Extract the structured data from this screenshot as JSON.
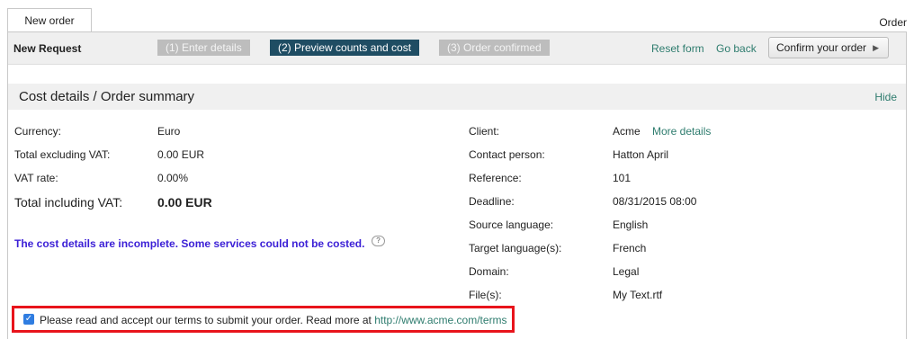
{
  "tab": {
    "label": "New order"
  },
  "header": {
    "order_link": "Order"
  },
  "toolbar": {
    "title": "New Request",
    "steps": [
      {
        "label": "(1) Enter details",
        "active": false
      },
      {
        "label": "(2) Preview counts and cost",
        "active": true
      },
      {
        "label": "(3) Order confirmed",
        "active": false
      }
    ],
    "reset_label": "Reset form",
    "back_label": "Go back",
    "confirm_label": "Confirm your order"
  },
  "section": {
    "title": "Cost details / Order summary",
    "hide_label": "Hide"
  },
  "costs": {
    "currency_label": "Currency:",
    "currency_value": "Euro",
    "excl_label": "Total excluding VAT:",
    "excl_value": "0.00 EUR",
    "vat_label": "VAT rate:",
    "vat_value": "0.00%",
    "incl_label": "Total including VAT:",
    "incl_value": "0.00 EUR",
    "warning": "The cost details are incomplete. Some services could not be costed."
  },
  "order": {
    "client_label": "Client:",
    "client_value": "Acme",
    "more_details": "More details",
    "contact_label": "Contact person:",
    "contact_value": "Hatton April",
    "reference_label": "Reference:",
    "reference_value": "101",
    "deadline_label": "Deadline:",
    "deadline_value": "08/31/2015 08:00",
    "source_label": "Source language:",
    "source_value": "English",
    "target_label": "Target language(s):",
    "target_value": "French",
    "domain_label": "Domain:",
    "domain_value": "Legal",
    "files_label": "File(s):",
    "files_value": "My Text.rtf"
  },
  "terms": {
    "checked": true,
    "text": "Please read and accept our terms to submit your order. Read more at ",
    "link": "http://www.acme.com/terms"
  },
  "colors": {
    "accent": "#2e7c6e",
    "active_step": "#1f4d63",
    "warning": "#3b1fd6",
    "highlight": "#e8141b",
    "checkbox": "#2f7de1"
  }
}
